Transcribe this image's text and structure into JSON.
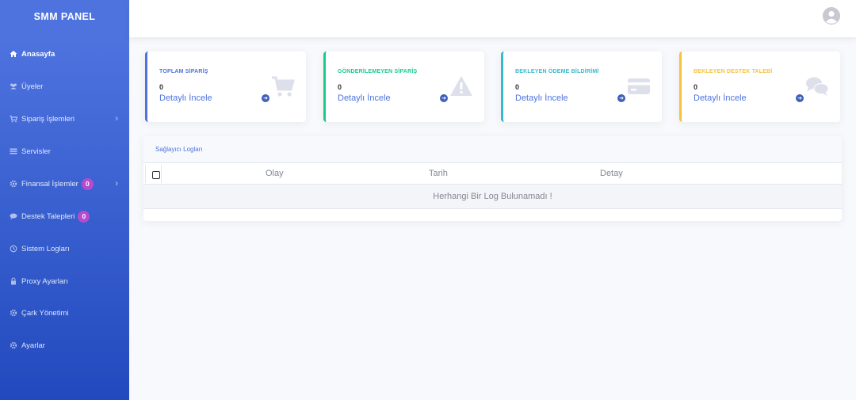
{
  "brand": "SMM PANEL",
  "sidebar": {
    "items": [
      {
        "label": "Anasayfa",
        "icon": "home-icon"
      },
      {
        "label": "Üyeler",
        "icon": "users-icon"
      },
      {
        "label": "Sipariş İşlemleri",
        "icon": "cart-icon"
      },
      {
        "label": "Servisler",
        "icon": "list-icon"
      },
      {
        "label": "Finansal İşlemler",
        "icon": "gear-icon",
        "badge": "0"
      },
      {
        "label": "Destek Talepleri",
        "icon": "chat-icon",
        "badge": "0"
      },
      {
        "label": "Sistem Logları",
        "icon": "history-icon"
      },
      {
        "label": "Proxy Ayarları",
        "icon": "lock-icon"
      },
      {
        "label": "Çark Yönetimi",
        "icon": "gear-icon"
      },
      {
        "label": "Ayarlar",
        "icon": "gear-icon"
      }
    ]
  },
  "cards": [
    {
      "title": "TOPLAM SİPARİŞ",
      "value": "0",
      "link": "Detaylı İncele",
      "color": "#4e73df",
      "icon": "cart-icon"
    },
    {
      "title": "GÖNDERİLEMEYEN SİPARİŞ",
      "value": "0",
      "link": "Detaylı İncele",
      "color": "#1cc88a",
      "icon": "warning-icon"
    },
    {
      "title": "BEKLEYEN ÖDEME BİLDİRİMİ",
      "value": "0",
      "link": "Detaylı İncele",
      "color": "#36b9cc",
      "icon": "credit-card-icon"
    },
    {
      "title": "BEKLEYEN DESTEK TALEBİ",
      "value": "0",
      "link": "Detaylı İncele",
      "color": "#f6c23e",
      "icon": "comments-icon"
    }
  ],
  "logs": {
    "title": "Sağlayıcı Logları",
    "columns": [
      "Olay",
      "Tarih",
      "Detay"
    ],
    "empty": "Herhangi Bir Log Bulunamadı !"
  }
}
